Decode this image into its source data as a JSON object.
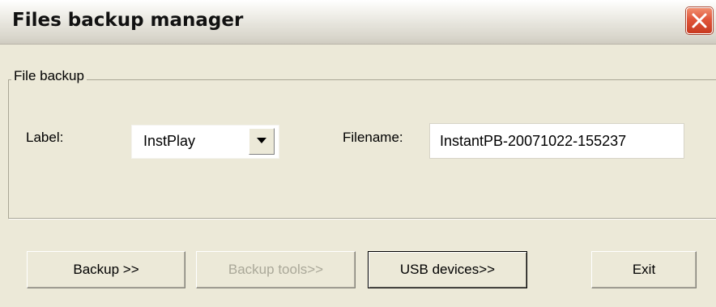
{
  "window": {
    "title": "Files backup manager",
    "close_icon": "close-icon"
  },
  "group": {
    "legend": "File backup"
  },
  "form": {
    "label_caption": "Label:",
    "label_value": "InstPlay",
    "filename_caption": "Filename:",
    "filename_value": "InstantPB-20071022-155237"
  },
  "buttons": {
    "backup": "Backup >>",
    "backup_tools": "Backup tools>>",
    "usb_devices": "USB devices>>",
    "exit": "Exit"
  },
  "colors": {
    "face": "#ece9d8",
    "close_red": "#e0553a",
    "disabled_text": "#aaa899"
  }
}
